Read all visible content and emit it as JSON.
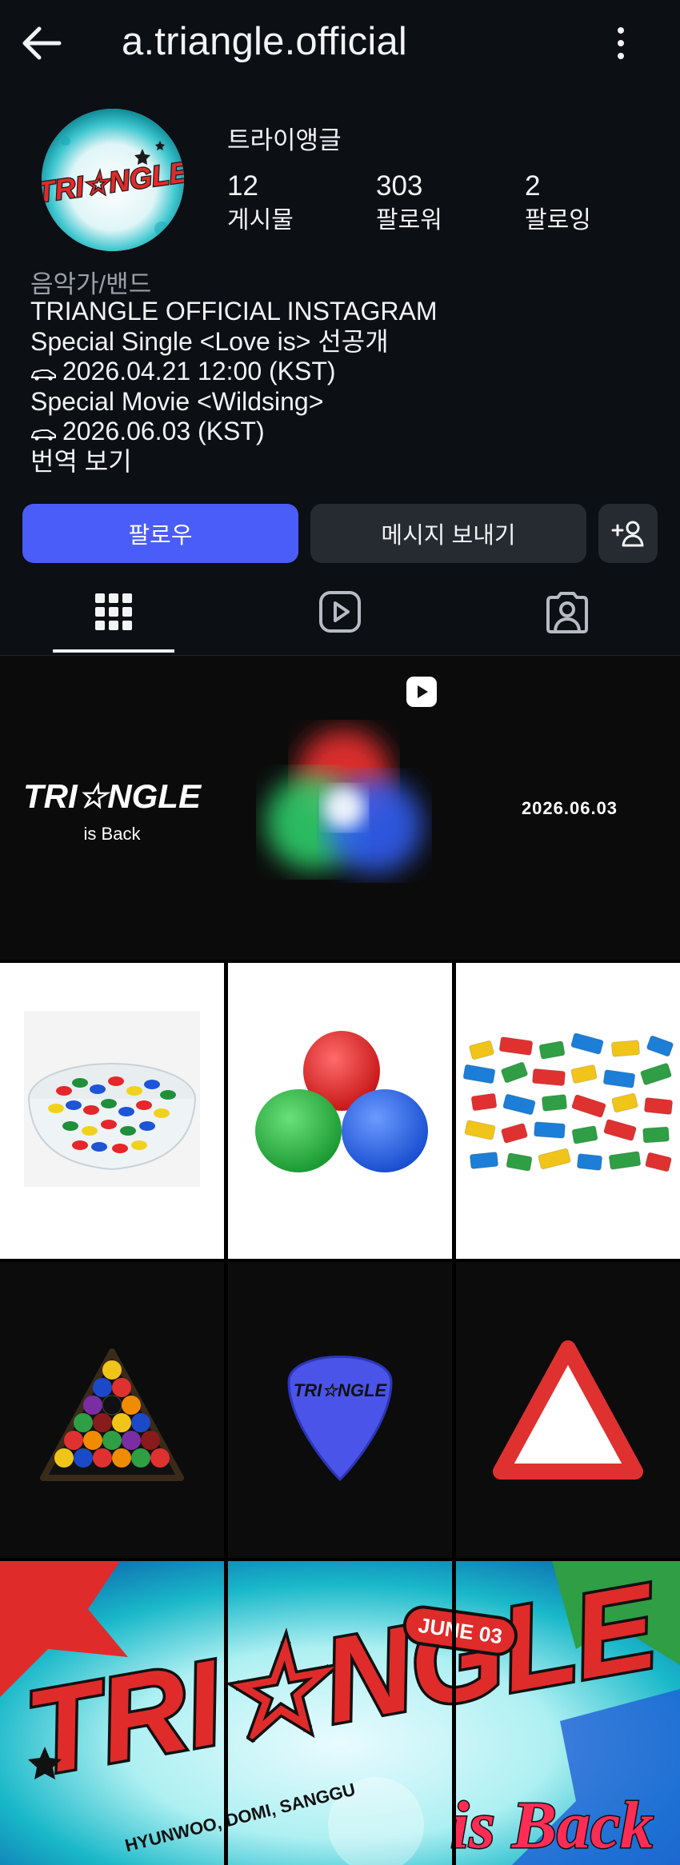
{
  "header": {
    "username": "a.triangle.official",
    "back_icon": "arrow-left-icon",
    "more_icon": "more-vertical-icon"
  },
  "profile": {
    "display_name": "트라이앵글",
    "avatar_logo_text": "TRI☆NGLE",
    "stats": [
      {
        "value": "12",
        "label": "게시물"
      },
      {
        "value": "303",
        "label": "팔로워"
      },
      {
        "value": "2",
        "label": "팔로잉"
      }
    ],
    "category": "음악가/밴드",
    "bio_lines": [
      "TRIANGLE OFFICIAL INSTAGRAM",
      "Special Single <Love is> 선공개",
      "2026.04.21 12:00 (KST)",
      "Special Movie <Wildsing>",
      "2026.06.03 (KST)"
    ],
    "translate_link": "번역 보기"
  },
  "actions": {
    "follow_label": "팔로우",
    "message_label": "메시지 보내기",
    "add_person_icon": "add-person-icon"
  },
  "tabs": [
    {
      "name": "posts",
      "icon": "grid-icon",
      "active": true
    },
    {
      "name": "reels",
      "icon": "reels-icon",
      "active": false
    },
    {
      "name": "tagged",
      "icon": "tagged-person-icon",
      "active": false
    }
  ],
  "posts": {
    "row1": {
      "logo_text": "TRI☆NGLE",
      "logo_sub": "is Back",
      "date_text": "2026.06.03",
      "reel_icon": "reel-play-icon"
    },
    "banner": {
      "title": "TRI☆NGLE",
      "subtitle": "is Back",
      "badge": "JUNE 03",
      "members": "HYUNWOO, DOMI, SANGGU"
    }
  },
  "colors": {
    "background": "#0c0f14",
    "accent_blue": "#4a5df9",
    "button_dark": "#262a31",
    "muted_text": "#9aa0a8"
  }
}
